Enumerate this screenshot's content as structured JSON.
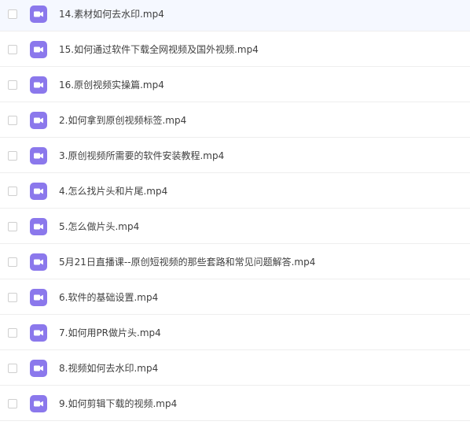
{
  "file_list": {
    "item_icon": "video-file-icon",
    "icon_color": "#8b78ec",
    "items": [
      {
        "name": "14.素材如何去水印.mp4",
        "checked": false
      },
      {
        "name": "15.如何通过软件下载全网视频及国外视频.mp4",
        "checked": false
      },
      {
        "name": "16.原创视频实操篇.mp4",
        "checked": false
      },
      {
        "name": "2.如何拿到原创视频标签.mp4",
        "checked": false
      },
      {
        "name": "3.原创视频所需要的软件安装教程.mp4",
        "checked": false
      },
      {
        "name": "4.怎么找片头和片尾.mp4",
        "checked": false
      },
      {
        "name": "5.怎么做片头.mp4",
        "checked": false
      },
      {
        "name": "5月21日直播课--原创短视频的那些套路和常见问题解答.mp4",
        "checked": false
      },
      {
        "name": "6.软件的基础设置.mp4",
        "checked": false
      },
      {
        "name": "7.如何用PR做片头.mp4",
        "checked": false
      },
      {
        "name": "8.视频如何去水印.mp4",
        "checked": false
      },
      {
        "name": "9.如何剪辑下载的视频.mp4",
        "checked": false
      }
    ]
  }
}
